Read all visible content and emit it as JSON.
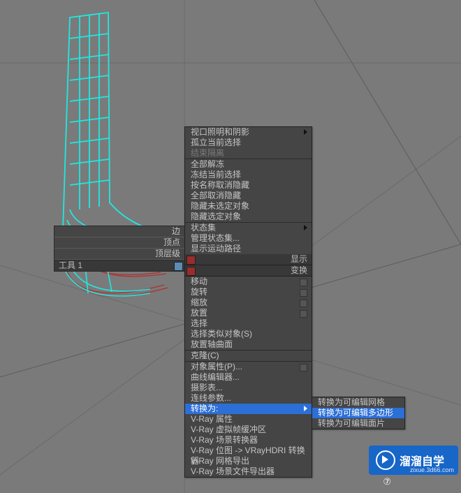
{
  "left_quad": {
    "rows": [
      "边",
      "顶点",
      "顶层级"
    ],
    "footer": "工具 1"
  },
  "ctx_header": {
    "top_right": "显示",
    "bottom_right": "变换"
  },
  "menu": {
    "viewport_lighting": "视口照明和阴影",
    "isolate_selection": "孤立当前选择",
    "end_isolate": "结束隔离",
    "unfreeze_all": "全部解冻",
    "freeze_selection": "冻结当前选择",
    "unhide_by_name": "按名称取消隐藏",
    "unhide_all": "全部取消隐藏",
    "hide_unselected": "隐藏未选定对象",
    "hide_selection": "隐藏选定对象",
    "state_sets": "状态集",
    "manage_state_sets": "管理状态集...",
    "show_motion_path": "显示运动路径",
    "move": "移动",
    "rotate": "旋转",
    "scale": "缩放",
    "placement": "放置",
    "select": "选择",
    "select_similar": "选择类似对象(S)",
    "place_pivot_surface": "放置轴曲面",
    "clone": "克隆(C)",
    "object_properties": "对象属性(P)...",
    "curve_editor": "曲线编辑器...",
    "dope_sheet": "摄影表...",
    "wire_parameters": "连线参数...",
    "convert_to": "转换为:",
    "vray_props": "V-Ray 属性",
    "vray_vfb": "V-Ray 虚拟帧缓冲区",
    "vray_scene_conv": "V-Ray 场景转换器",
    "vray_bitmap": "V-Ray 位图 -> VRayHDRI 转换器",
    "vray_mesh_export": "V-Ray 网格导出",
    "vray_scene_export": "V-Ray 场景文件导出器"
  },
  "submenu": {
    "to_editable_mesh": "转换为可编辑网格",
    "to_editable_poly": "转换为可编辑多边形",
    "to_editable_patch": "转换为可编辑面片"
  },
  "brand": {
    "title": "溜溜自学",
    "url": "zixue.3d66.com"
  },
  "page_num": "⑦"
}
